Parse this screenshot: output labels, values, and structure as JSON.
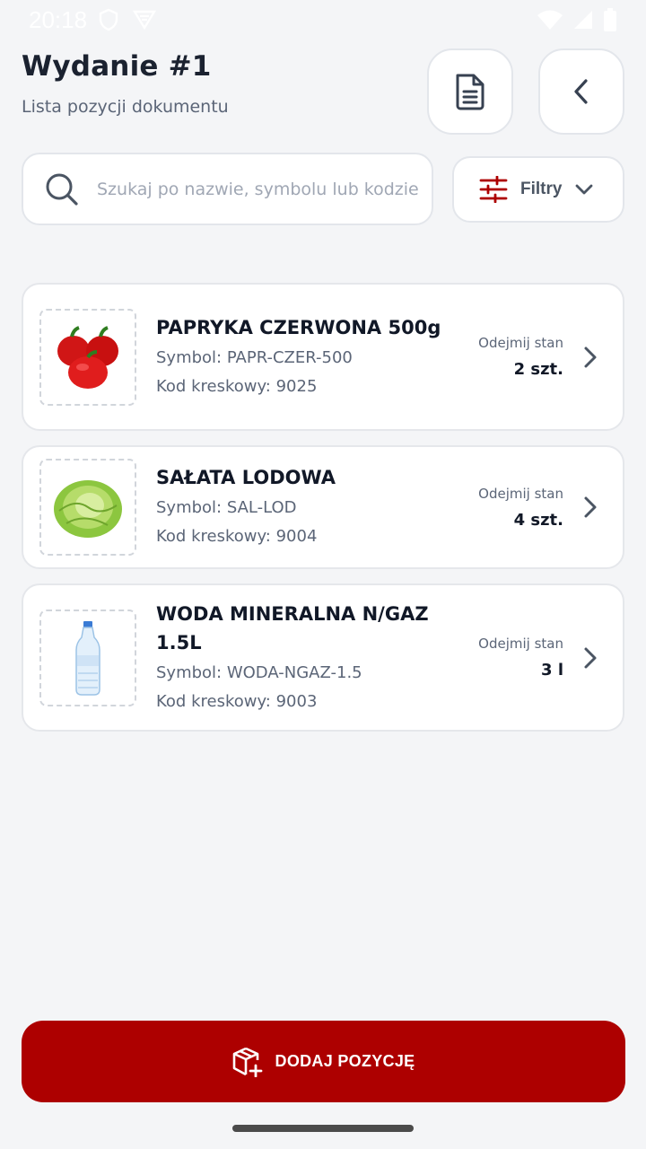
{
  "status_bar": {
    "time": "20:18"
  },
  "header": {
    "title": "Wydanie #1",
    "subtitle": "Lista pozycji dokumentu"
  },
  "search": {
    "placeholder": "Szukaj po nazwie, symbolu lub kodzie",
    "value": ""
  },
  "filter": {
    "label": "Filtry"
  },
  "items": [
    {
      "name": "PAPRYKA CZERWONA 500g",
      "symbol": "Symbol: PAPR-CZER-500",
      "barcode": "Kod kreskowy: 9025",
      "qty_label": "Odejmij stan",
      "qty_value": "2 szt.",
      "image_icon": "red-pepper-icon"
    },
    {
      "name": "SAŁATA LODOWA",
      "symbol": "Symbol: SAL-LOD",
      "barcode": "Kod kreskowy: 9004",
      "qty_label": "Odejmij stan",
      "qty_value": "4 szt.",
      "image_icon": "lettuce-icon"
    },
    {
      "name": "WODA MINERALNA N/GAZ 1.5L",
      "symbol": "Symbol: WODA-NGAZ-1.5",
      "barcode": "Kod kreskowy: 9003",
      "qty_label": "Odejmij stan",
      "qty_value": "3 l",
      "image_icon": "water-bottle-icon"
    }
  ],
  "add_button": {
    "label": "DODAJ POZYCJĘ"
  },
  "colors": {
    "accent": "#ad0000",
    "background": "#f4f5f7",
    "muted_text": "#5b6577"
  }
}
